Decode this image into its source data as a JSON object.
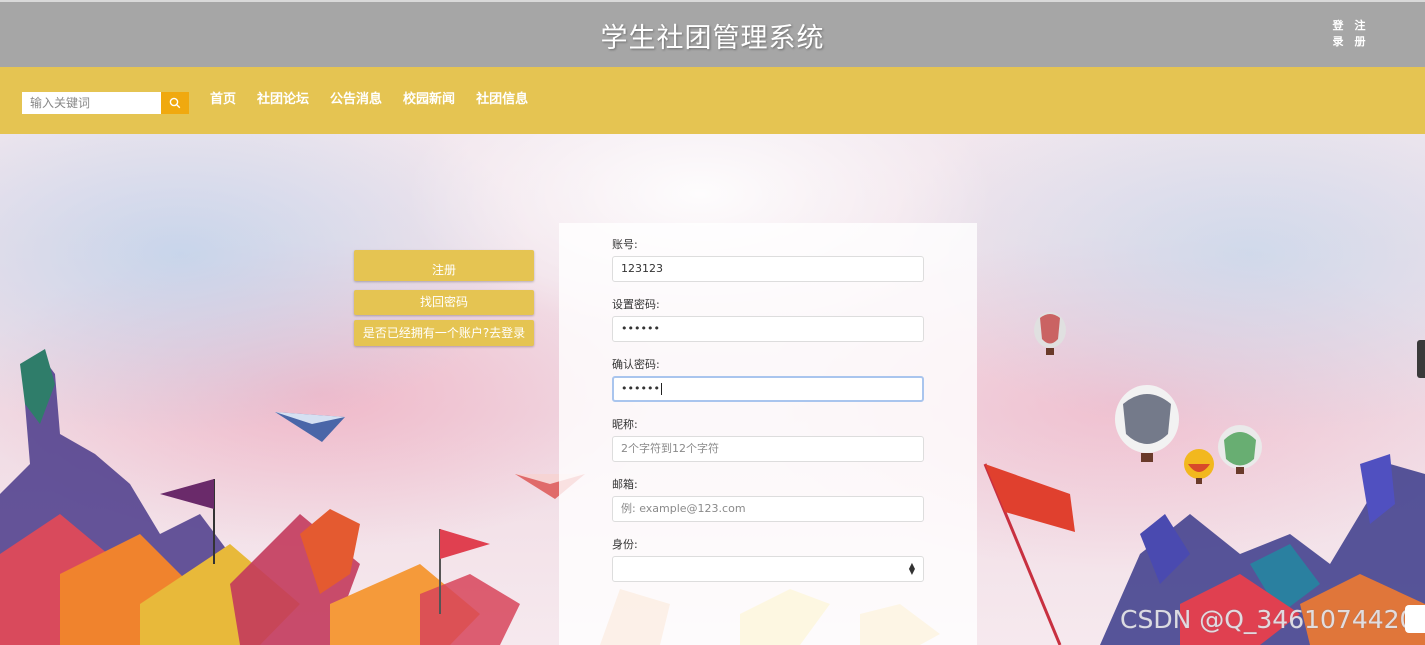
{
  "header": {
    "title": "学生社团管理系统",
    "auth": {
      "login_label": "登录",
      "register_label": "注册"
    }
  },
  "nav": {
    "search": {
      "placeholder": "输入关键词",
      "icon": "search-icon"
    },
    "items": [
      {
        "label": "首页"
      },
      {
        "label": "社团论坛"
      },
      {
        "label": "公告消息"
      },
      {
        "label": "校园新闻"
      },
      {
        "label": "社团信息"
      }
    ]
  },
  "side_buttons": {
    "register": "注册",
    "recover": "找回密码",
    "goto_login": "是否已经拥有一个账户?去登录"
  },
  "form": {
    "account": {
      "label": "账号:",
      "value": "123123"
    },
    "password": {
      "label": "设置密码:",
      "value": "••••••"
    },
    "confirm_password": {
      "label": "确认密码:",
      "value": "••••••"
    },
    "nickname": {
      "label": "昵称:",
      "placeholder": "2个字符到12个字符"
    },
    "email": {
      "label": "邮箱:",
      "placeholder": "例: example@123.com"
    },
    "identity": {
      "label": "身份:",
      "value": ""
    }
  },
  "watermark": "CSDN @Q_3461074420",
  "colors": {
    "header_bg": "#a6a6a6",
    "nav_bg": "#e5c452",
    "search_btn": "#f0a90f",
    "focus_border": "#a9c5ee"
  }
}
